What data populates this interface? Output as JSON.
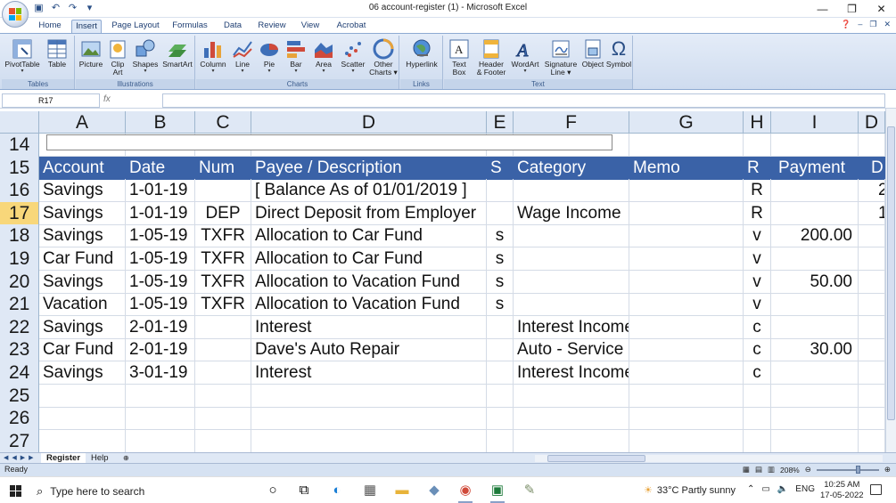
{
  "window": {
    "title": "06 account-register (1) - Microsoft Excel",
    "controls": {
      "minimize": "—",
      "maximize": "❐",
      "close": "✕"
    },
    "quick_access": [
      "save-icon",
      "undo-icon",
      "redo-icon",
      "customize-icon"
    ]
  },
  "ribbon": {
    "tabs": [
      "Home",
      "Insert",
      "Page Layout",
      "Formulas",
      "Data",
      "Review",
      "View",
      "Acrobat"
    ],
    "active_tab": "Insert",
    "groups": [
      {
        "label": "Tables",
        "buttons": [
          {
            "label": "PivotTable",
            "sub": "▾"
          },
          {
            "label": "Table"
          }
        ]
      },
      {
        "label": "Illustrations",
        "buttons": [
          {
            "label": "Picture"
          },
          {
            "label": "Clip",
            "label2": "Art"
          },
          {
            "label": "Shapes",
            "sub": "▾"
          },
          {
            "label": "SmartArt"
          }
        ]
      },
      {
        "label": "Charts",
        "buttons": [
          {
            "label": "Column",
            "sub": "▾"
          },
          {
            "label": "Line",
            "sub": "▾"
          },
          {
            "label": "Pie",
            "sub": "▾"
          },
          {
            "label": "Bar",
            "sub": "▾"
          },
          {
            "label": "Area",
            "sub": "▾"
          },
          {
            "label": "Scatter",
            "sub": "▾"
          },
          {
            "label": "Other",
            "label2": "Charts ▾"
          }
        ]
      },
      {
        "label": "Links",
        "buttons": [
          {
            "label": "Hyperlink"
          }
        ]
      },
      {
        "label": "Text",
        "buttons": [
          {
            "label": "Text",
            "label2": "Box"
          },
          {
            "label": "Header",
            "label2": "& Footer"
          },
          {
            "label": "WordArt",
            "sub": "▾"
          },
          {
            "label": "Signature",
            "label2": "Line ▾"
          },
          {
            "label": "Object"
          },
          {
            "label": "Symbol"
          }
        ]
      }
    ]
  },
  "formula_bar": {
    "name_box": "R17",
    "fx": "fx",
    "value": ""
  },
  "sheet": {
    "columns": [
      "A",
      "B",
      "C",
      "D",
      "E",
      "F",
      "G",
      "H",
      "I",
      "D"
    ],
    "header_row": {
      "row_num": "15",
      "cells": [
        "Account",
        "Date",
        "Num",
        "Payee / Description",
        "S",
        "Category",
        "Memo",
        "R",
        "Payment",
        "D"
      ]
    },
    "rows": [
      {
        "num": "14",
        "cells": [
          "",
          "",
          "",
          "",
          "",
          "",
          "",
          "",
          "",
          ""
        ]
      },
      {
        "num": "16",
        "cells": [
          "Savings",
          "1-01-19",
          "",
          "[ Balance As of 01/01/2019 ]",
          "",
          "",
          "",
          "R",
          "",
          "2"
        ]
      },
      {
        "num": "17",
        "cells": [
          "Savings",
          "1-01-19",
          "DEP",
          "Direct Deposit from Employer",
          "",
          "Wage Income",
          "",
          "R",
          "",
          "1"
        ]
      },
      {
        "num": "18",
        "cells": [
          "Savings",
          "1-05-19",
          "TXFR",
          "Allocation to Car Fund",
          "s",
          "",
          "",
          "v",
          "200.00",
          ""
        ]
      },
      {
        "num": "19",
        "cells": [
          "Car Fund",
          "1-05-19",
          "TXFR",
          "Allocation to Car Fund",
          "s",
          "",
          "",
          "v",
          "",
          ""
        ]
      },
      {
        "num": "20",
        "cells": [
          "Savings",
          "1-05-19",
          "TXFR",
          "Allocation to Vacation Fund",
          "s",
          "",
          "",
          "v",
          "50.00",
          ""
        ]
      },
      {
        "num": "21",
        "cells": [
          "Vacation",
          "1-05-19",
          "TXFR",
          "Allocation to Vacation Fund",
          "s",
          "",
          "",
          "v",
          "",
          ""
        ]
      },
      {
        "num": "22",
        "cells": [
          "Savings",
          "2-01-19",
          "",
          "Interest",
          "",
          "Interest Income",
          "",
          "c",
          "",
          ""
        ]
      },
      {
        "num": "23",
        "cells": [
          "Car Fund",
          "2-01-19",
          "",
          "Dave's Auto Repair",
          "",
          "Auto - Service",
          "",
          "c",
          "30.00",
          ""
        ]
      },
      {
        "num": "24",
        "cells": [
          "Savings",
          "3-01-19",
          "",
          "Interest",
          "",
          "Interest Income",
          "",
          "c",
          "",
          ""
        ]
      },
      {
        "num": "25",
        "cells": [
          "",
          "",
          "",
          "",
          "",
          "",
          "",
          "",
          "",
          ""
        ]
      },
      {
        "num": "26",
        "cells": [
          "",
          "",
          "",
          "",
          "",
          "",
          "",
          "",
          "",
          ""
        ]
      },
      {
        "num": "27",
        "cells": [
          "",
          "",
          "",
          "",
          "",
          "",
          "",
          "",
          "",
          ""
        ]
      }
    ],
    "selected_row": "17",
    "sheet_tabs": [
      "Register",
      "Help"
    ],
    "active_sheet": "Register"
  },
  "status": {
    "ready": "Ready",
    "zoom": "208%"
  },
  "taskbar": {
    "search_placeholder": "Type here to search",
    "weather": "33°C  Partly sunny",
    "lang": "ENG",
    "time": "10:25 AM",
    "date": "17-05-2022"
  },
  "colors": {
    "header_fill": "#3a62a7",
    "selected_row_header": "#f8d77a",
    "ribbon": "#dfe9f7"
  }
}
